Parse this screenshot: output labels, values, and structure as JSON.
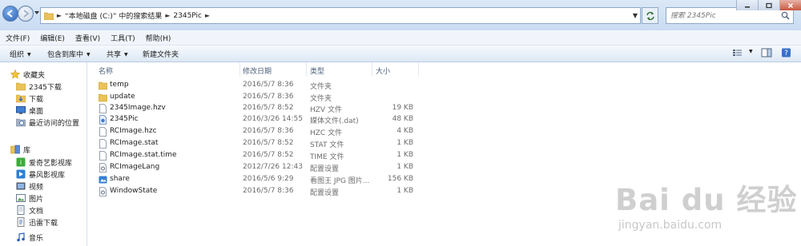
{
  "address": {
    "breadcrumbs": [
      "“本地磁盘 (C:)” 中的搜索结果",
      "2345Pic"
    ],
    "separator": "►"
  },
  "search": {
    "placeholder": "搜索 2345Pic"
  },
  "menu": [
    "文件(F)",
    "编辑(E)",
    "查看(V)",
    "工具(T)",
    "帮助(H)"
  ],
  "commands": {
    "organize": "组织",
    "include_in_library": "包含到库中",
    "share": "共享",
    "new_folder": "新建文件夹"
  },
  "nav": {
    "favorites": "收藏夹",
    "favorites_items": [
      "2345下载",
      "下载",
      "桌面",
      "最近访问的位置"
    ],
    "libraries": "库",
    "libraries_items": [
      "爱奇艺影视库",
      "暴风影视库",
      "视频",
      "图片",
      "文档",
      "迅雷下载",
      "音乐"
    ]
  },
  "columns": {
    "name": "名称",
    "modified": "修改日期",
    "type": "类型",
    "size": "大小"
  },
  "files": [
    {
      "name": "temp",
      "modified": "2016/5/7 8:36",
      "type": "文件夹",
      "size": "",
      "icon": "folder-icon"
    },
    {
      "name": "update",
      "modified": "2016/5/7 8:36",
      "type": "文件夹",
      "size": "",
      "icon": "folder-icon"
    },
    {
      "name": "2345Image.hzv",
      "modified": "2016/5/7 8:52",
      "type": "HZV 文件",
      "size": "19 KB",
      "icon": "file-icon"
    },
    {
      "name": "2345Pic",
      "modified": "2016/3/26 14:55",
      "type": "媒体文件(.dat)",
      "size": "48 KB",
      "icon": "media-file-icon"
    },
    {
      "name": "RCImage.hzc",
      "modified": "2016/5/7 8:36",
      "type": "HZC 文件",
      "size": "4 KB",
      "icon": "file-icon"
    },
    {
      "name": "RCImage.stat",
      "modified": "2016/5/7 8:52",
      "type": "STAT 文件",
      "size": "1 KB",
      "icon": "file-icon"
    },
    {
      "name": "RCImage.stat.time",
      "modified": "2016/5/7 8:52",
      "type": "TIME 文件",
      "size": "1 KB",
      "icon": "file-icon"
    },
    {
      "name": "RCImageLang",
      "modified": "2012/7/26 12:43",
      "type": "配置设置",
      "size": "1 KB",
      "icon": "config-file-icon"
    },
    {
      "name": "share",
      "modified": "2016/5/6 9:29",
      "type": "看图王 JPG 图片...",
      "size": "156 KB",
      "icon": "image-file-icon"
    },
    {
      "name": "WindowState",
      "modified": "2016/5/7 8:36",
      "type": "配置设置",
      "size": "1 KB",
      "icon": "config-file-icon"
    }
  ],
  "watermark": {
    "logo": "Bai du 经验",
    "url": "jingyan.baidu.com"
  },
  "colors": {
    "folder": "#e9c25a",
    "address_bar_bg": "#d3e3f6",
    "header_text": "#4c607a",
    "accent": "#2b62b8"
  }
}
